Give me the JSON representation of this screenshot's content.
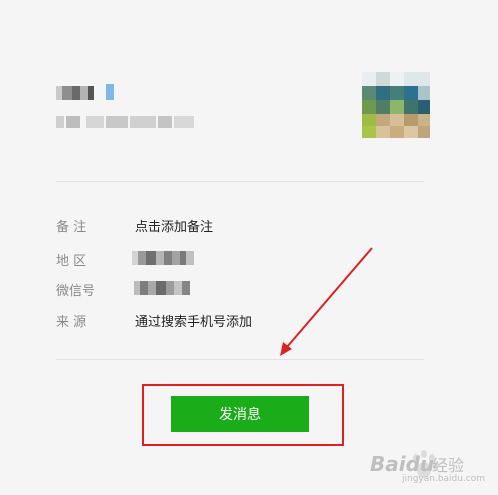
{
  "profile": {
    "name_pixelated": true,
    "subtitle_pixelated": true,
    "avatar_pixelated": true
  },
  "details": {
    "remark_label": "备 注",
    "remark_value": "点击添加备注",
    "region_label": "地 区",
    "wechat_id_label": "微信号",
    "source_label": "来 源",
    "source_value": "通过搜索手机号添加"
  },
  "actions": {
    "send_message_label": "发消息"
  },
  "annotation": {
    "highlight_color": "#e02020",
    "arrow_color": "#e02020"
  },
  "watermark": {
    "brand": "Baidu",
    "sub": "经验",
    "url": "jingyan.baidu.com"
  },
  "colors": {
    "button_green": "#1aad19",
    "background": "#f5f5f5"
  }
}
